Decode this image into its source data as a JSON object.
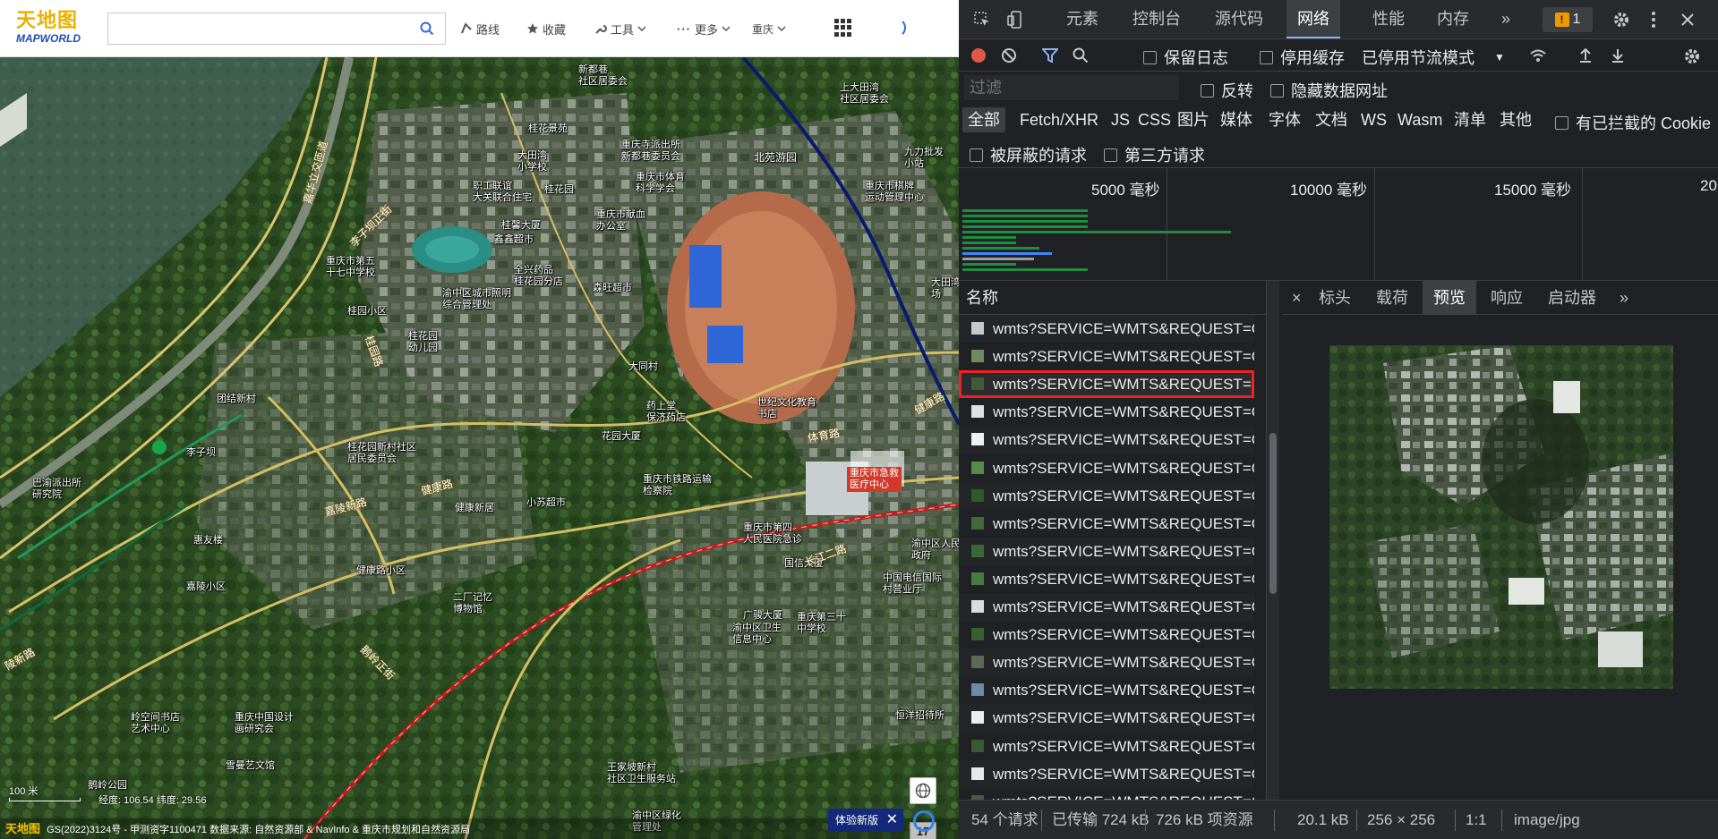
{
  "map_app": {
    "logo_cn": "天地图",
    "logo_en": "MAPWORLD",
    "search_placeholder": "",
    "tools": [
      {
        "label": "路线",
        "icon": "route-icon"
      },
      {
        "label": "收藏",
        "icon": "star-icon"
      },
      {
        "label": "工具",
        "icon": "wrench-icon"
      },
      {
        "label": "更多",
        "icon": "more-icon"
      },
      {
        "label": "重庆",
        "icon": "chevron-down-icon"
      }
    ],
    "zoom_level": "17",
    "zoom_in": "+",
    "zoom_out": "-",
    "scale_text": "100 米",
    "coords_text": "经度: 106.54  纬度: 29.56",
    "copyright": "GS(2022)3124号 - 甲测资字1100471 数据来源: 自然资源部 & NavInfo & 重庆市规划和自然资源局",
    "copyright_logo": "天地图",
    "try_new": "体验新版",
    "labels": [
      {
        "text": "新都巷\n社区居委会"
      },
      {
        "text": "桂花景苑"
      },
      {
        "text": "大田湾\n小学校"
      },
      {
        "text": "重庆寺派出所\n新都巷委员会"
      },
      {
        "text": "北苑游园"
      },
      {
        "text": "九力批发\n小站"
      },
      {
        "text": "重庆市棋牌\n运动管理中心"
      },
      {
        "text": "重庆市体育\n科学学会"
      },
      {
        "text": "桂花园"
      },
      {
        "text": "职工联谊\n大关联合住宅"
      },
      {
        "text": "重庆市献血\n办公室"
      },
      {
        "text": "桂馨大厦"
      },
      {
        "text": "鑫鑫超市"
      },
      {
        "text": "重庆市第五\n十七中学校"
      },
      {
        "text": "全兴药品\n桂花园分店"
      },
      {
        "text": "森旺超市"
      },
      {
        "text": "渝中区城市照明\n综合管理处"
      },
      {
        "text": "桂园小区"
      },
      {
        "text": "桂花园\n幼儿园"
      },
      {
        "text": "大同村"
      },
      {
        "text": "世纪文化教育\n书店"
      },
      {
        "text": "团结新村"
      },
      {
        "text": "药上堂\n保济药店"
      },
      {
        "text": "花园大厦"
      },
      {
        "text": "李子坝"
      },
      {
        "text": "桂花园新村社区\n居民委员会"
      },
      {
        "text": "巴渝派出所\n研究院"
      },
      {
        "text": "重庆市铁路运输\n检察院"
      },
      {
        "text": "健康新居"
      },
      {
        "text": "小苏超市"
      },
      {
        "text": "重庆市第四\n人民医院急诊"
      },
      {
        "text": "国信大厦"
      },
      {
        "text": "惠友楼"
      },
      {
        "text": "健康路小区"
      },
      {
        "text": "嘉陵小区"
      },
      {
        "text": "二厂记忆\n博物馆"
      },
      {
        "text": "广骏大厦"
      },
      {
        "text": "渝中区卫生\n信息中心"
      },
      {
        "text": "重庆第三十\n中学校"
      },
      {
        "text": "渝中区人民\n政府"
      },
      {
        "text": "中国电信国际\n村营业厅"
      },
      {
        "text": "重庆中国设计\n画研究会"
      },
      {
        "text": "岭空间书店\n艺术中心"
      },
      {
        "text": "雪曼艺文馆"
      },
      {
        "text": "王家坡新村\n社区卫生服务站"
      },
      {
        "text": "渝中区绿化\n管理处"
      },
      {
        "text": "恒洋招待所"
      },
      {
        "text": "鹅岭公园"
      },
      {
        "text": "上大田湾\n社区居委会"
      },
      {
        "text": "大田湾体育\n场"
      }
    ],
    "road_labels": [
      {
        "text": "嘉华立交匝道"
      },
      {
        "text": "李子坝正街"
      },
      {
        "text": "桂园路"
      },
      {
        "text": "嘉陵新路"
      },
      {
        "text": "健康路"
      },
      {
        "text": "体育路"
      },
      {
        "text": "长江二路"
      },
      {
        "text": "鹅岭正街"
      },
      {
        "text": "健康路"
      },
      {
        "text": "陵新路"
      }
    ],
    "poi_red": "重庆市急救\n医疗中心",
    "station_label": "李子坝"
  },
  "devtools": {
    "tabs": [
      "元素",
      "控制台",
      "源代码",
      "网络",
      "性能",
      "内存"
    ],
    "active_tab": "网络",
    "more_tabs": "»",
    "issues_count": "1",
    "toolbar": {
      "preserve_log": "保留日志",
      "disable_cache": "停用缓存",
      "throttle": "已停用节流模式"
    },
    "filter_placeholder": "过滤",
    "invert": "反转",
    "hide_data_urls": "隐藏数据网址",
    "types": [
      "全部",
      "Fetch/XHR",
      "JS",
      "CSS",
      "图片",
      "媒体",
      "字体",
      "文档",
      "WS",
      "Wasm",
      "清单",
      "其他"
    ],
    "blocked_cookies": "有已拦截的 Cookie",
    "blocked_requests": "被屏蔽的请求",
    "third_party": "第三方请求",
    "timeline_ticks": [
      "5000 毫秒",
      "10000 毫秒",
      "15000 毫秒",
      "20"
    ],
    "name_header": "名称",
    "requests": [
      "wmts?SERVICE=WMTS&REQUEST=GetTile",
      "wmts?SERVICE=WMTS&REQUEST=GetTile",
      "wmts?SERVICE=WMTS&REQUEST=GetTile",
      "wmts?SERVICE=WMTS&REQUEST=GetTile",
      "wmts?SERVICE=WMTS&REQUEST=GetTile",
      "wmts?SERVICE=WMTS&REQUEST=GetTile",
      "wmts?SERVICE=WMTS&REQUEST=GetTile",
      "wmts?SERVICE=WMTS&REQUEST=GetTile",
      "wmts?SERVICE=WMTS&REQUEST=GetTile",
      "wmts?SERVICE=WMTS&REQUEST=GetTile",
      "wmts?SERVICE=WMTS&REQUEST=GetTile",
      "wmts?SERVICE=WMTS&REQUEST=GetTile",
      "wmts?SERVICE=WMTS&REQUEST=GetTile",
      "wmts?SERVICE=WMTS&REQUEST=GetTile",
      "wmts?SERVICE=WMTS&REQUEST=GetTile",
      "wmts?SERVICE=WMTS&REQUEST=GetTile",
      "wmts?SERVICE=WMTS&REQUEST=GetTile",
      "wmts?SERVICE=WMTS&REQUEST=GetTile"
    ],
    "selected_request_index": 2,
    "detail_close": "×",
    "detail_tabs": [
      "标头",
      "载荷",
      "预览",
      "响应",
      "启动器"
    ],
    "detail_active": "预览",
    "detail_more": "»",
    "status": {
      "requests": "54 个请求",
      "transferred": "已传输 724 kB",
      "resources": "726 kB 项资源",
      "size": "20.1 kB",
      "dims": "256 × 256",
      "ratio": "1:1",
      "mime": "image/jpg"
    },
    "colors": {
      "record": "#e2574c",
      "filter_active": "#8ab4f8",
      "issues_badge": "#f29900"
    }
  }
}
